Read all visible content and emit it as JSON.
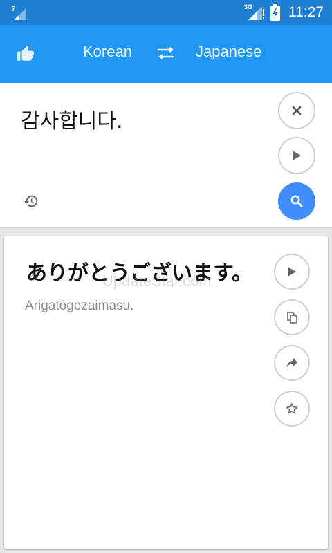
{
  "status_bar": {
    "network": "3G",
    "time": "11:27"
  },
  "app_bar": {
    "source_language": "Korean",
    "target_language": "Japanese",
    "icons": [
      "thumbs-up-icon",
      "swap-icon"
    ]
  },
  "input": {
    "text": "감사합니다."
  },
  "output": {
    "translation": "ありがとうございます。",
    "transliteration": "Arigatōgozaimasu.",
    "watermark": "UpdateStar.com"
  },
  "colors": {
    "status_bar": "#1f7fd4",
    "app_bar": "#2196f3",
    "search_button": "#3f8efc"
  }
}
